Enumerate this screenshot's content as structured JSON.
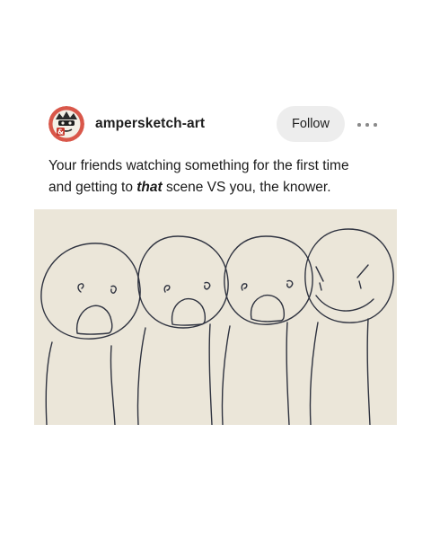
{
  "post": {
    "author": {
      "username": "ampersketch-art",
      "avatar_icon": "avatar-sketch-ampersand"
    },
    "actions": {
      "follow_label": "Follow",
      "more_icon": "more-horizontal-icon"
    },
    "caption": {
      "line1": "Your friends watching something for the first time",
      "line2_before": "and getting to ",
      "line2_emphasis": "that",
      "line2_after": " scene VS you, the knower."
    },
    "image": {
      "icon": "drawing-four-stick-figures",
      "background_color": "#ebe6d9",
      "ink_color": "#2f3340"
    }
  },
  "colors": {
    "avatar_ring": "#d9574a",
    "follow_bg": "#ededed",
    "text": "#1a1a1a"
  }
}
